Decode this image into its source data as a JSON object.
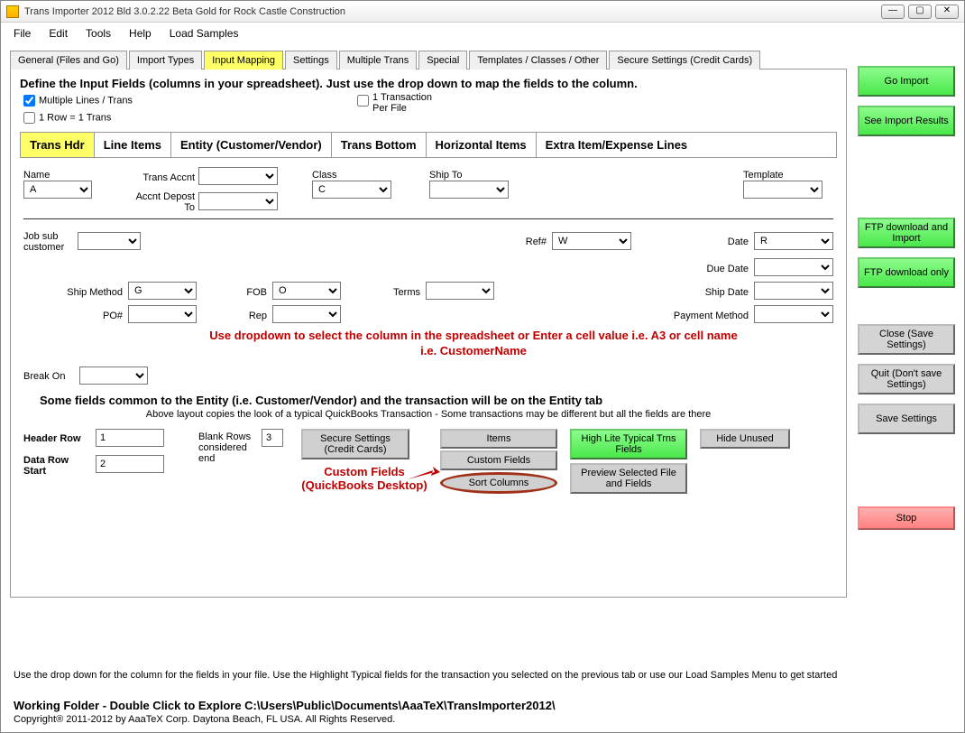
{
  "window": {
    "title": "Trans Importer 2012 Bld 3.0.2.22 Beta Gold  for Rock Castle Construction"
  },
  "menu": {
    "file": "File",
    "edit": "Edit",
    "tools": "Tools",
    "help": "Help",
    "load_samples": "Load Samples"
  },
  "tabs": {
    "general": "General (Files and Go)",
    "import_types": "Import Types",
    "input_mapping": "Input Mapping",
    "settings": "Settings",
    "multiple_trans": "Multiple Trans",
    "special": "Special",
    "templates": "Templates / Classes / Other",
    "secure": "Secure Settings (Credit Cards)"
  },
  "panel": {
    "instruct": "Define the Input Fields (columns in your spreadsheet). Just use the drop down to map the fields to the column.",
    "chk_multiple": "Multiple Lines / Trans",
    "chk_one_row": "1 Row = 1 Trans",
    "chk_one_trans": "1 Transaction Per File",
    "chk_multiple_checked": true,
    "chk_one_row_checked": false,
    "chk_one_trans_checked": false
  },
  "subtabs": {
    "trans_hdr": "Trans Hdr",
    "line_items": "Line Items",
    "entity": "Entity (Customer/Vendor)",
    "trans_bottom": "Trans Bottom",
    "horizontal": "Horizontal Items",
    "extra": "Extra Item/Expense Lines"
  },
  "fields": {
    "name": "Name",
    "name_val": "A",
    "trans_accnt": "Trans Accnt",
    "trans_accnt_val": "",
    "accnt_deposit": "Accnt Depost To",
    "accnt_deposit_val": "",
    "class": "Class",
    "class_val": "C",
    "ship_to": "Ship To",
    "ship_to_val": "",
    "template": "Template",
    "template_val": "",
    "job": "Job sub customer",
    "job_val": "",
    "ref": "Ref#",
    "ref_val": "W",
    "date": "Date",
    "date_val": "R",
    "due_date": "Due Date",
    "due_date_val": "",
    "ship_method": "Ship Method",
    "ship_method_val": "G",
    "po": "PO#",
    "po_val": "",
    "fob": "FOB",
    "fob_val": "O",
    "rep": "Rep",
    "rep_val": "",
    "ship_date": "Ship Date",
    "ship_date_val": "",
    "terms": "Terms",
    "terms_val": "",
    "payment_method": "Payment Method",
    "payment_method_val": "",
    "break_on": "Break On",
    "break_on_val": ""
  },
  "help": {
    "red1": "Use dropdown to select the column in the spreadsheet or Enter a cell value i.e. A3 or cell name i.e. CustomerName",
    "entity_note": "Some fields common to the Entity (i.e. Customer/Vendor) and the transaction will be on the Entity tab",
    "copies_note": "Above layout copies the look of a typical QuickBooks Transaction - Some transactions may be different but all the fields are there",
    "custom_fields_anno": "Custom Fields (QuickBooks Desktop)"
  },
  "bottom": {
    "header_row": "Header Row",
    "header_row_val": "1",
    "data_row": "Data Row Start",
    "data_row_val": "2",
    "blank_rows": "Blank Rows considered end",
    "blank_rows_val": "3",
    "secure": "Secure Settings (Credit Cards)",
    "items": "Items",
    "custom_fields": "Custom Fields",
    "sort_columns": "Sort Columns",
    "highlite": "High Lite Typical Trns Fields",
    "preview": "Preview Selected File and Fields",
    "hide_unused": "Hide Unused"
  },
  "side": {
    "go_import": "Go Import",
    "see_results": "See Import Results",
    "ftp_import": "FTP download and Import",
    "ftp_only": "FTP download only",
    "close": "Close (Save Settings)",
    "quit": "Quit (Don't save Settings)",
    "save": "Save Settings",
    "stop": "Stop"
  },
  "footer": {
    "hint": "Use the drop down for the column for the fields in your file. Use the Highlight Typical fields for the transaction you selected on the previous tab or use our Load Samples Menu to get started",
    "working_folder": "Working Folder - Double Click to Explore C:\\Users\\Public\\Documents\\AaaTeX\\TransImporter2012\\",
    "copyright": "Copyright® 2011-2012 by AaaTeX Corp. Daytona Beach, FL USA. All Rights Reserved."
  }
}
